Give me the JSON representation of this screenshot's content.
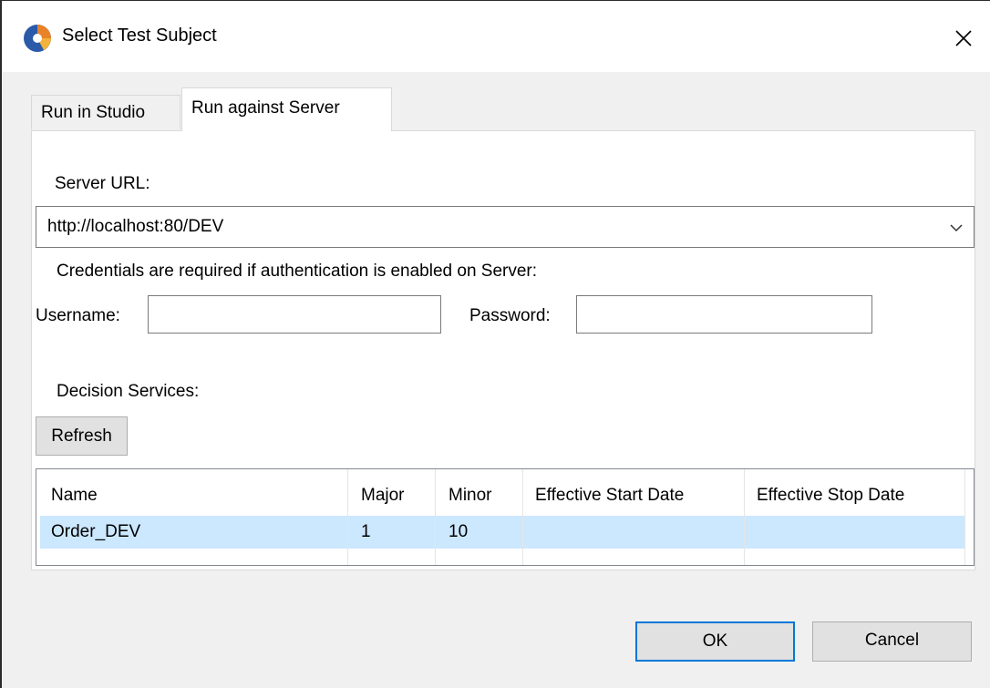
{
  "window": {
    "title": "Select Test Subject",
    "icon": "app-logo-icon",
    "close_icon": "close-icon"
  },
  "tabs": [
    {
      "label": "Run in Studio",
      "active": false
    },
    {
      "label": "Run against Server",
      "active": true
    }
  ],
  "server": {
    "url_label": "Server URL:",
    "url_value": "http://localhost:80/DEV",
    "credentials_note": "Credentials are required if authentication is enabled on Server:",
    "username_label": "Username:",
    "username_value": "",
    "password_label": "Password:",
    "password_value": ""
  },
  "services": {
    "label": "Decision Services:",
    "refresh_label": "Refresh",
    "columns": [
      "Name",
      "Major",
      "Minor",
      "Effective Start Date",
      "Effective Stop Date"
    ],
    "rows": [
      {
        "name": "Order_DEV",
        "major": "1",
        "minor": "10",
        "start": "",
        "stop": "",
        "selected": true
      }
    ]
  },
  "footer": {
    "ok_label": "OK",
    "cancel_label": "Cancel"
  },
  "colors": {
    "selection": "#cce8ff",
    "focus_border": "#0078d7",
    "dialog_bg": "#f0f0f0"
  }
}
